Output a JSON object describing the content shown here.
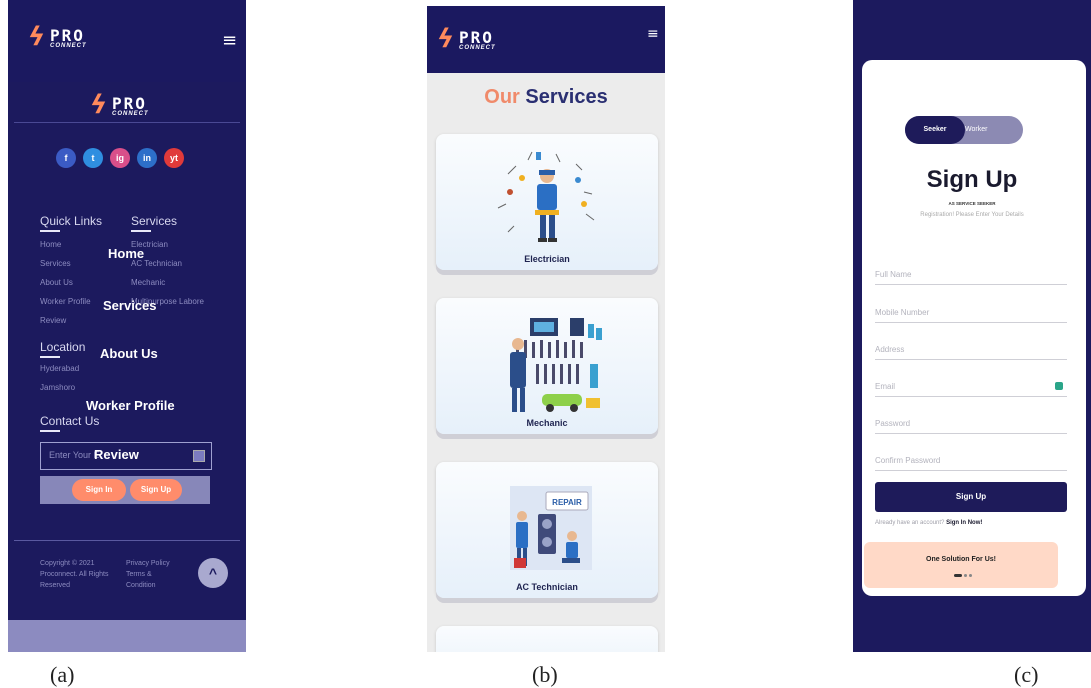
{
  "colors": {
    "navy": "#1c1a5e",
    "accent": "#ff8c6b",
    "promo": "#ffd9c7"
  },
  "logo": {
    "name": "PRO",
    "tag": "CONNECT"
  },
  "icons": {
    "menu": "hamburger-icon",
    "scroll_top": "chevron-up-icon",
    "email": "email-icon"
  },
  "footer_panel": {
    "social": [
      "f",
      "t",
      "ig",
      "in",
      "yt"
    ],
    "quick_links": {
      "heading": "Quick Links",
      "items": [
        "Home",
        "Services",
        "About Us",
        "Worker Profile",
        "Review"
      ]
    },
    "services": {
      "heading": "Services",
      "items": [
        "Electrician",
        "AC Technician",
        "Mechanic",
        "Multipurpose Labore"
      ]
    },
    "location": {
      "heading": "Location",
      "items": [
        "Hyderabad",
        "Jamshoro"
      ]
    },
    "contact": {
      "heading": "Contact Us",
      "placeholder": "Enter Your E",
      "sign_in": "Sign In",
      "sign_up": "Sign Up"
    },
    "menu_overlay": [
      "Home",
      "Services",
      "About Us",
      "Worker Profile",
      "Review"
    ],
    "copyright": [
      "Copyright © 2021",
      "Proconnect. All Rights",
      "Reserved"
    ],
    "legal": [
      "Privacy Policy",
      "Terms &",
      "Condition"
    ]
  },
  "services_panel": {
    "title_part1": "Our",
    "title_part2": "Services",
    "cards": [
      {
        "label": "Electrician",
        "icon": "electrician-illustration"
      },
      {
        "label": "Mechanic",
        "icon": "mechanic-illustration"
      },
      {
        "label": "AC Technician",
        "icon": "ac-technician-illustration"
      }
    ],
    "banner_text": "REPAIR"
  },
  "signup_panel": {
    "toggle": {
      "active": "Seeker",
      "inactive": "Worker"
    },
    "title": "Sign Up",
    "subtitle": "AS SERVICE SEEKER",
    "description": "Registration! Please Enter Your Details",
    "fields": [
      "Full Name",
      "Mobile Number",
      "Address",
      "Email",
      "Password",
      "Confirm Password"
    ],
    "button": "Sign Up",
    "already_text": "Already have an account?",
    "sign_in_link": "Sign In Now!",
    "promo": "One Solution For Us!"
  },
  "captions": [
    "(a)",
    "(b)",
    "(c)"
  ]
}
